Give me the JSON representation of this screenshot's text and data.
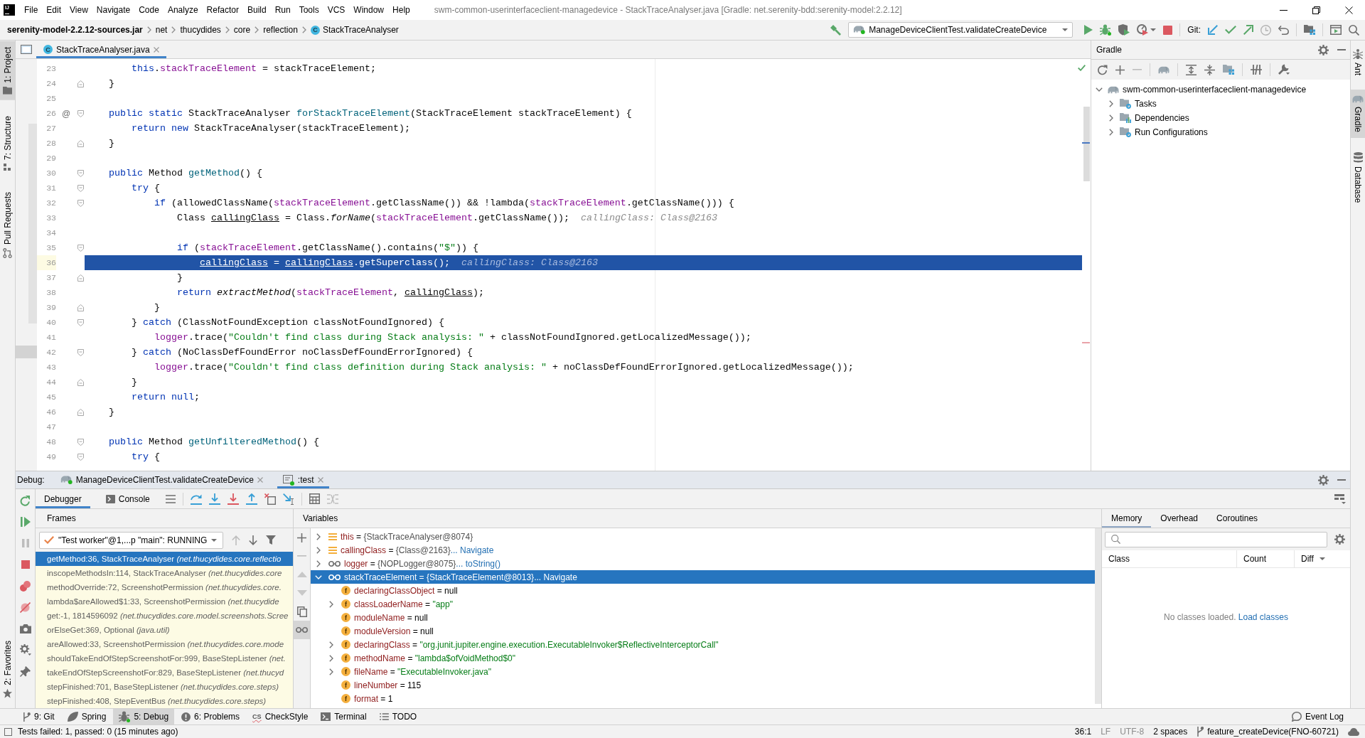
{
  "title_bar": {
    "logo": "IJ",
    "menu": [
      "File",
      "Edit",
      "View",
      "Navigate",
      "Code",
      "Analyze",
      "Refactor",
      "Build",
      "Run",
      "Tools",
      "VCS",
      "Window",
      "Help"
    ],
    "title": "swm-common-userinterfaceclient-managedevice - StackTraceAnalyser.java [Gradle: net.serenity-bdd:serenity-model:2.2.12]"
  },
  "nav_bar": {
    "breadcrumbs": [
      {
        "label": "serenity-model-2.2.12-sources.jar",
        "kind": "jar"
      },
      {
        "label": "net",
        "kind": "package"
      },
      {
        "label": "thucydides",
        "kind": "package"
      },
      {
        "label": "core",
        "kind": "package"
      },
      {
        "label": "reflection",
        "kind": "package"
      },
      {
        "label": "StackTraceAnalyser",
        "kind": "class",
        "badge": "C"
      }
    ],
    "run_configuration": "ManageDeviceClientTest.validateCreateDevice",
    "vcs_label": "Git:"
  },
  "left_tool_strip": {
    "top": [
      {
        "label": "1: Project",
        "kind": "project",
        "selected": true
      },
      {
        "label": "7: Structure",
        "kind": "structure",
        "selected": false
      },
      {
        "label": "Pull Requests",
        "kind": "pull_requests",
        "selected": false
      }
    ],
    "bottom": [
      {
        "label": "2: Favorites",
        "kind": "favorites",
        "selected": false
      }
    ]
  },
  "right_tool_strip": [
    {
      "label": "Ant",
      "kind": "ant",
      "selected": false
    },
    {
      "label": "Gradle",
      "kind": "gradle",
      "selected": true
    },
    {
      "label": "Database",
      "kind": "database",
      "selected": false
    }
  ],
  "editor": {
    "tabs": [
      {
        "label": "StackTraceAnalyser.java",
        "badge": "C",
        "selected": true
      }
    ],
    "lines": [
      {
        "number": "23",
        "tokens": [
          {
            "kind": "keyword",
            "text": "        this"
          },
          {
            "kind": "plain",
            "text": "."
          },
          {
            "kind": "field",
            "text": "stackTraceElement"
          },
          {
            "kind": "plain",
            "text": " = stackTraceElement;"
          }
        ]
      },
      {
        "number": "24",
        "fold_end": true,
        "tokens": [
          {
            "kind": "plain",
            "text": "    }"
          }
        ]
      },
      {
        "number": "25"
      },
      {
        "number": "26",
        "gutter_mark": "@",
        "fold_start": true,
        "tokens": [
          {
            "kind": "keyword",
            "text": "    public static"
          },
          {
            "kind": "plain",
            "text": " StackTraceAnalyser "
          },
          {
            "kind": "declaration",
            "text": "forStackTraceElement"
          },
          {
            "kind": "plain",
            "text": "(StackTraceElement stackTraceElement) {"
          }
        ]
      },
      {
        "number": "27",
        "tokens": [
          {
            "kind": "keyword",
            "text": "        return new"
          },
          {
            "kind": "plain",
            "text": " StackTraceAnalyser(stackTraceElement);"
          }
        ]
      },
      {
        "number": "28",
        "fold_end": true,
        "tokens": [
          {
            "kind": "plain",
            "text": "    }"
          }
        ]
      },
      {
        "number": "29"
      },
      {
        "number": "30",
        "fold_start": true,
        "tokens": [
          {
            "kind": "keyword",
            "text": "    public"
          },
          {
            "kind": "plain",
            "text": " Method "
          },
          {
            "kind": "declaration",
            "text": "getMethod"
          },
          {
            "kind": "plain",
            "text": "() {"
          }
        ]
      },
      {
        "number": "31",
        "fold_start": true,
        "tokens": [
          {
            "kind": "keyword",
            "text": "        try"
          },
          {
            "kind": "plain",
            "text": " {"
          }
        ]
      },
      {
        "number": "32",
        "fold_start": true,
        "tokens": [
          {
            "kind": "keyword",
            "text": "            if"
          },
          {
            "kind": "plain",
            "text": " (allowedClassName("
          },
          {
            "kind": "field",
            "text": "stackTraceElement"
          },
          {
            "kind": "plain",
            "text": ".getClassName()) && !lambda("
          },
          {
            "kind": "field",
            "text": "stackTraceElement"
          },
          {
            "kind": "plain",
            "text": ".getClassName())) {"
          }
        ]
      },
      {
        "number": "33",
        "tokens": [
          {
            "kind": "plain",
            "text": "                Class "
          },
          {
            "kind": "reassigned",
            "text": "callingClass"
          },
          {
            "kind": "plain",
            "text": " = Class."
          },
          {
            "kind": "static_call",
            "text": "forName"
          },
          {
            "kind": "plain",
            "text": "("
          },
          {
            "kind": "field",
            "text": "stackTraceElement"
          },
          {
            "kind": "plain",
            "text": ".getClassName());"
          }
        ],
        "hint": "callingClass: Class@2163"
      },
      {
        "number": "34"
      },
      {
        "number": "35",
        "fold_start": true,
        "tokens": [
          {
            "kind": "keyword",
            "text": "                if"
          },
          {
            "kind": "plain",
            "text": " ("
          },
          {
            "kind": "field",
            "text": "stackTraceElement"
          },
          {
            "kind": "plain",
            "text": ".getClassName().contains("
          },
          {
            "kind": "string",
            "text": "\"$\""
          },
          {
            "kind": "plain",
            "text": ")) {"
          }
        ]
      },
      {
        "number": "36",
        "current": true,
        "tokens": [
          {
            "kind": "reassigned",
            "text": "                    callingClass"
          },
          {
            "kind": "plain",
            "text": " = "
          },
          {
            "kind": "reassigned",
            "text": "callingClass"
          },
          {
            "kind": "plain",
            "text": ".getSuperclass();"
          }
        ],
        "hint": "callingClass: Class@2163"
      },
      {
        "number": "37",
        "fold_end": true,
        "tokens": [
          {
            "kind": "plain",
            "text": "                }"
          }
        ]
      },
      {
        "number": "38",
        "tokens": [
          {
            "kind": "keyword",
            "text": "                return "
          },
          {
            "kind": "static_call",
            "text": "extractMethod"
          },
          {
            "kind": "plain",
            "text": "("
          },
          {
            "kind": "field",
            "text": "stackTraceElement"
          },
          {
            "kind": "plain",
            "text": ", "
          },
          {
            "kind": "reassigned",
            "text": "callingClass"
          },
          {
            "kind": "plain",
            "text": ");"
          }
        ]
      },
      {
        "number": "39",
        "fold_end": true,
        "tokens": [
          {
            "kind": "plain",
            "text": "            }"
          }
        ]
      },
      {
        "number": "40",
        "fold_start": true,
        "tokens": [
          {
            "kind": "plain",
            "text": "        } "
          },
          {
            "kind": "keyword",
            "text": "catch"
          },
          {
            "kind": "plain",
            "text": " (ClassNotFoundException classNotFoundIgnored) {"
          }
        ]
      },
      {
        "number": "41",
        "tokens": [
          {
            "kind": "field",
            "text": "            logger"
          },
          {
            "kind": "plain",
            "text": ".trace("
          },
          {
            "kind": "string",
            "text": "\"Couldn't find class during Stack analysis: \""
          },
          {
            "kind": "plain",
            "text": " + classNotFoundIgnored.getLocalizedMessage());"
          }
        ]
      },
      {
        "number": "42",
        "fold_start": true,
        "tokens": [
          {
            "kind": "plain",
            "text": "        } "
          },
          {
            "kind": "keyword",
            "text": "catch"
          },
          {
            "kind": "plain",
            "text": " (NoClassDefFoundError noClassDefFoundErrorIgnored) {"
          }
        ]
      },
      {
        "number": "43",
        "tokens": [
          {
            "kind": "field",
            "text": "            logger"
          },
          {
            "kind": "plain",
            "text": ".trace("
          },
          {
            "kind": "string",
            "text": "\"Couldn't find class definition during Stack analysis: \""
          },
          {
            "kind": "plain",
            "text": " + noClassDefFoundErrorIgnored.getLocalizedMessage());"
          }
        ]
      },
      {
        "number": "44",
        "fold_end": true,
        "tokens": [
          {
            "kind": "plain",
            "text": "        }"
          }
        ]
      },
      {
        "number": "45",
        "tokens": [
          {
            "kind": "keyword",
            "text": "        return null"
          },
          {
            "kind": "plain",
            "text": ";"
          }
        ]
      },
      {
        "number": "46",
        "fold_end": true,
        "tokens": [
          {
            "kind": "plain",
            "text": "    }"
          }
        ]
      },
      {
        "number": "47"
      },
      {
        "number": "48",
        "fold_start": true,
        "tokens": [
          {
            "kind": "keyword",
            "text": "    public"
          },
          {
            "kind": "plain",
            "text": " Method "
          },
          {
            "kind": "declaration",
            "text": "getUnfilteredMethod"
          },
          {
            "kind": "plain",
            "text": "() {"
          }
        ]
      },
      {
        "number": "49",
        "fold_start": true,
        "tokens": [
          {
            "kind": "keyword",
            "text": "        try"
          },
          {
            "kind": "plain",
            "text": " {"
          }
        ]
      }
    ]
  },
  "gradle": {
    "title": "Gradle",
    "tree": [
      {
        "label": "swm-common-userinterfaceclient-managedevice",
        "kind": "project",
        "expanded": true,
        "selected": false,
        "children": [
          {
            "label": "Tasks",
            "kind": "tasks",
            "expanded": false,
            "selected": false
          },
          {
            "label": "Dependencies",
            "kind": "dependencies",
            "expanded": false,
            "selected": false
          },
          {
            "label": "Run Configurations",
            "kind": "run_configurations",
            "expanded": false,
            "selected": false
          }
        ]
      }
    ]
  },
  "debug": {
    "label": "Debug:",
    "tabs": [
      {
        "label": "ManageDeviceClientTest.validateCreateDevice",
        "kind": "gradle_run",
        "selected": false
      },
      {
        "label": ":test",
        "kind": "task",
        "selected": true
      }
    ],
    "subtabs": [
      {
        "label": "Debugger",
        "kind": "debugger",
        "selected": true
      },
      {
        "label": "Console",
        "kind": "console",
        "selected": false
      }
    ],
    "frames": {
      "title": "Frames",
      "thread": "\"Test worker\"@1,...p \"main\": RUNNING",
      "items": [
        {
          "text": "getMethod:36, StackTraceAnalyser *(net.thucydides.core.reflectio*",
          "selected": true
        },
        {
          "text": "inscopeMethodsIn:114, StackTraceAnalyser *(net.thucydides.core*",
          "selected": false
        },
        {
          "text": "methodOverride:72, ScreenshotPermission *(net.thucydides.core.*",
          "selected": false
        },
        {
          "text": "lambda$areAllowed$1:33, ScreenshotPermission *(net.thucydide*",
          "selected": false
        },
        {
          "text": "get:-1, 1814596092 *(net.thucydides.core.model.screenshots.Scree*",
          "selected": false
        },
        {
          "text": "orElseGet:369, Optional *(java.util)*",
          "selected": false
        },
        {
          "text": "areAllowed:33, ScreenshotPermission *(net.thucydides.core.mode*",
          "selected": false
        },
        {
          "text": "shouldTakeEndOfStepScreenshotFor:999, BaseStepListener *(net.*",
          "selected": false
        },
        {
          "text": "takeEndOfStepScreenshotFor:829, BaseStepListener *(net.thucyd*",
          "selected": false
        },
        {
          "text": "stepFinished:701, BaseStepListener *(net.thucydides.core.steps)*",
          "selected": false
        },
        {
          "text": "stepFinished:408, StepEventBus *(net.thucydides.core.steps)*",
          "selected": false
        }
      ]
    },
    "variables": {
      "title": "Variables",
      "watches_shown": true,
      "items": [
        {
          "name": "this",
          "op": "=",
          "value": {
            "kind": "object",
            "text": "{StackTraceAnalyser@8074}"
          },
          "kind": "local",
          "expanded": false,
          "selected": false
        },
        {
          "name": "callingClass",
          "op": "=",
          "value": {
            "kind": "object",
            "text": "{Class@2163}"
          },
          "link": "... Navigate",
          "kind": "local",
          "expanded": false,
          "selected": false
        },
        {
          "name": "logger",
          "op": "=",
          "value": {
            "kind": "object",
            "text": "{NOPLogger@8075}"
          },
          "link": "... toString()",
          "kind": "watch",
          "expanded": false,
          "selected": false
        },
        {
          "name": "stackTraceElement",
          "op": "=",
          "value": {
            "kind": "object",
            "text": "{StackTraceElement@8013}"
          },
          "link": "... Navigate",
          "kind": "watch",
          "expanded": true,
          "selected": true,
          "children": [
            {
              "name": "declaringClassObject",
              "op": "=",
              "value": {
                "kind": "null",
                "text": "null"
              },
              "kind": "field",
              "badge": "f",
              "selected": false
            },
            {
              "name": "classLoaderName",
              "op": "=",
              "value": {
                "kind": "string",
                "text": "\"app\""
              },
              "kind": "field",
              "badge": "f",
              "expanded": false,
              "selected": false
            },
            {
              "name": "moduleName",
              "op": "=",
              "value": {
                "kind": "null",
                "text": "null"
              },
              "kind": "field",
              "badge": "f",
              "selected": false
            },
            {
              "name": "moduleVersion",
              "op": "=",
              "value": {
                "kind": "null",
                "text": "null"
              },
              "kind": "field",
              "badge": "f",
              "selected": false
            },
            {
              "name": "declaringClass",
              "op": "=",
              "value": {
                "kind": "string",
                "text": "\"org.junit.jupiter.engine.execution.ExecutableInvoker$ReflectiveInterceptorCall\""
              },
              "kind": "field",
              "badge": "f",
              "expanded": false,
              "selected": false
            },
            {
              "name": "methodName",
              "op": "=",
              "value": {
                "kind": "string",
                "text": "\"lambda$ofVoidMethod$0\""
              },
              "kind": "field",
              "badge": "f",
              "expanded": false,
              "selected": false
            },
            {
              "name": "fileName",
              "op": "=",
              "value": {
                "kind": "string",
                "text": "\"ExecutableInvoker.java\""
              },
              "kind": "field",
              "badge": "f",
              "expanded": false,
              "selected": false
            },
            {
              "name": "lineNumber",
              "op": "=",
              "value": {
                "kind": "number",
                "text": "115"
              },
              "kind": "field",
              "badge": "f",
              "selected": false
            },
            {
              "name": "format",
              "op": "=",
              "value": {
                "kind": "number",
                "text": "1"
              },
              "kind": "field",
              "badge": "f",
              "selected": false
            }
          ]
        }
      ]
    },
    "memory": {
      "tabs": [
        {
          "label": "Memory",
          "selected": true
        },
        {
          "label": "Overhead",
          "selected": false
        },
        {
          "label": "Coroutines",
          "selected": false
        }
      ],
      "columns": [
        {
          "label": "Class"
        },
        {
          "label": "Count"
        },
        {
          "label": "Diff",
          "sorted": true
        }
      ],
      "empty_text": "No classes loaded.",
      "empty_link": "Load classes"
    }
  },
  "tool_window_bar": {
    "items": [
      {
        "label": "9: Git",
        "kind": "git",
        "selected": false
      },
      {
        "label": "Spring",
        "kind": "spring",
        "selected": false
      },
      {
        "label": "5: Debug",
        "kind": "debug",
        "selected": true
      },
      {
        "label": "6: Problems",
        "kind": "problems",
        "selected": false
      },
      {
        "label": "CheckStyle",
        "kind": "checkstyle",
        "badge": "CS",
        "selected": false
      },
      {
        "label": "Terminal",
        "kind": "terminal",
        "selected": false
      },
      {
        "label": "TODO",
        "kind": "todo",
        "selected": false
      }
    ],
    "event_log": "Event Log"
  },
  "status_bar": {
    "message": "Tests failed: 1, passed: 0 (15 minutes ago)",
    "caret_position": "36:1",
    "line_separator": "LF",
    "encoding": "UTF-8",
    "indent": "2 spaces",
    "branch": "feature_createDevice(FNO-60721)"
  }
}
